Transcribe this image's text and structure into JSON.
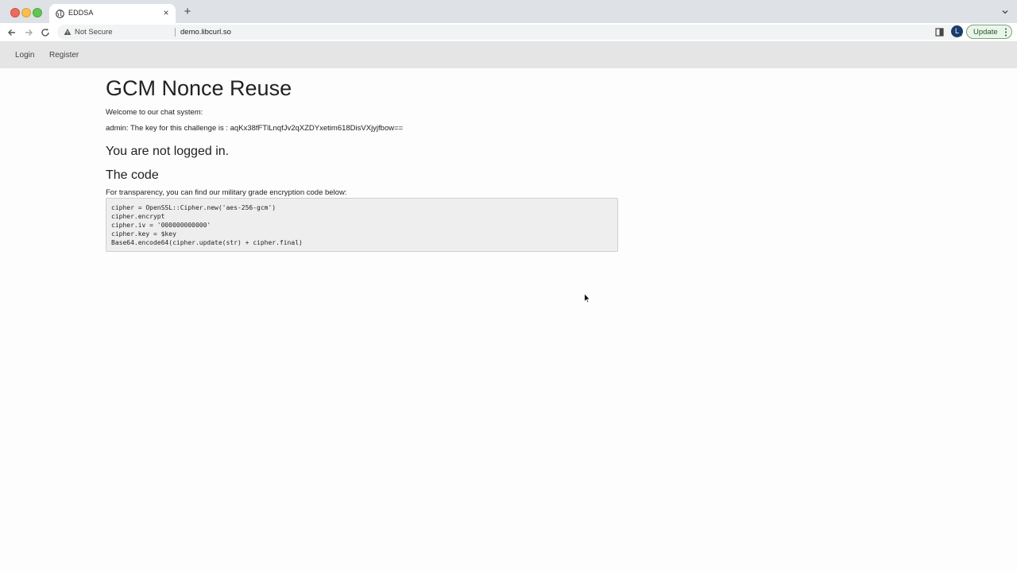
{
  "browser": {
    "tab_title": "EDDSA",
    "new_tab_symbol": "+",
    "close_symbol": "×",
    "security_label": "Not Secure",
    "url": "demo.libcurl.so",
    "profile_initial": "L",
    "update_label": "Update"
  },
  "site_nav": {
    "login_label": "Login",
    "register_label": "Register"
  },
  "main": {
    "title": "GCM Nonce Reuse",
    "welcome": "Welcome to our chat system:",
    "admin_message": "admin: The key for this challenge is : aqKx38fFTlLnqfJv2qXZDYxetim618DisVXjyjfbow==",
    "status_heading": "You are not logged in.",
    "code_heading": "The code",
    "code_intro": "For transparency, you can find our military grade encryption code below:",
    "code_lines": [
      "cipher = OpenSSL::Cipher.new('aes-256-gcm')",
      "cipher.encrypt",
      "cipher.iv = '000000000000'",
      "cipher.key = $key",
      "Base64.encode64(cipher.update(str) + cipher.final)"
    ]
  },
  "icons": {
    "favicon": "globe-icon",
    "back": "arrow-left-icon",
    "forward": "arrow-right-icon",
    "reload": "reload-icon",
    "warning": "warning-triangle-icon",
    "share": "share-icon",
    "bookmark": "star-icon",
    "side_panel": "side-panel-icon",
    "menu": "kebab-menu-icon",
    "tab_list": "chevron-down-icon",
    "pointer": "mouse-cursor-icon"
  }
}
